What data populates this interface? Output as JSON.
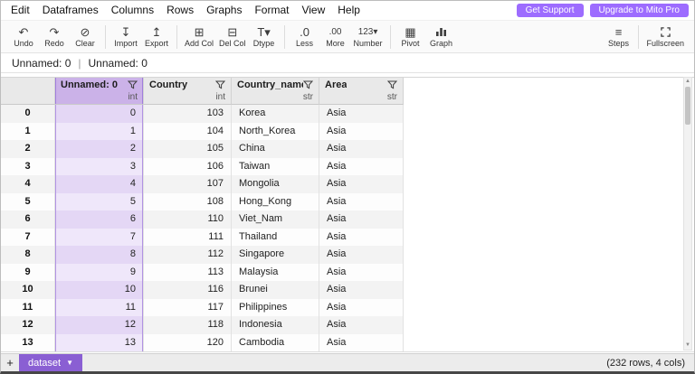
{
  "brand": {
    "accent_purple": "#9d6cff",
    "tab_purple": "#8a5fd3",
    "selected_header": "#cbb2e8",
    "selected_cell": "#efe7fa",
    "selected_cell_alt": "#e4d7f5"
  },
  "menu": {
    "items": [
      "Edit",
      "Dataframes",
      "Columns",
      "Rows",
      "Graphs",
      "Format",
      "View",
      "Help"
    ]
  },
  "header_actions": {
    "get_support": "Get Support",
    "upgrade": "Upgrade to Mito Pro"
  },
  "toolbar": {
    "groups": [
      [
        {
          "name": "undo",
          "label": "Undo",
          "icon": "undo-icon"
        },
        {
          "name": "redo",
          "label": "Redo",
          "icon": "redo-icon"
        },
        {
          "name": "clear",
          "label": "Clear",
          "icon": "clear-icon"
        }
      ],
      [
        {
          "name": "import",
          "label": "Import",
          "icon": "import-icon"
        },
        {
          "name": "export",
          "label": "Export",
          "icon": "export-icon"
        }
      ],
      [
        {
          "name": "add-col",
          "label": "Add Col",
          "icon": "add-col-icon"
        },
        {
          "name": "del-col",
          "label": "Del Col",
          "icon": "del-col-icon"
        },
        {
          "name": "dtype",
          "label": "Dtype",
          "icon": "dtype-icon"
        }
      ],
      [
        {
          "name": "less",
          "label": "Less",
          "icon": "less-icon"
        },
        {
          "name": "more",
          "label": "More",
          "icon": "more-icon"
        },
        {
          "name": "number",
          "label": "Number",
          "icon": "number-icon"
        }
      ],
      [
        {
          "name": "pivot",
          "label": "Pivot",
          "icon": "pivot-icon"
        },
        {
          "name": "graph",
          "label": "Graph",
          "icon": "graph-icon"
        }
      ]
    ],
    "right": [
      {
        "name": "steps",
        "label": "Steps",
        "icon": "steps-icon"
      },
      {
        "name": "fullscreen",
        "label": "Fullscreen",
        "icon": "fullscreen-icon"
      }
    ]
  },
  "formula_bar": {
    "cell_ref": "Unnamed: 0",
    "separator": "|",
    "value": "Unnamed: 0"
  },
  "grid": {
    "columns": [
      {
        "key": "unnamed0",
        "name": "Unnamed: 0",
        "dtype": "int",
        "align": "right",
        "selected": true
      },
      {
        "key": "country",
        "name": "Country",
        "dtype": "int",
        "align": "right",
        "selected": false
      },
      {
        "key": "country-name",
        "name": "Country_name",
        "dtype": "str",
        "align": "left",
        "selected": false
      },
      {
        "key": "area",
        "name": "Area",
        "dtype": "str",
        "align": "left",
        "selected": false
      }
    ],
    "rows": [
      {
        "index": "0",
        "cells": [
          "0",
          "103",
          "Korea",
          "Asia"
        ]
      },
      {
        "index": "1",
        "cells": [
          "1",
          "104",
          "North_Korea",
          "Asia"
        ]
      },
      {
        "index": "2",
        "cells": [
          "2",
          "105",
          "China",
          "Asia"
        ]
      },
      {
        "index": "3",
        "cells": [
          "3",
          "106",
          "Taiwan",
          "Asia"
        ]
      },
      {
        "index": "4",
        "cells": [
          "4",
          "107",
          "Mongolia",
          "Asia"
        ]
      },
      {
        "index": "5",
        "cells": [
          "5",
          "108",
          "Hong_Kong",
          "Asia"
        ]
      },
      {
        "index": "6",
        "cells": [
          "6",
          "110",
          "Viet_Nam",
          "Asia"
        ]
      },
      {
        "index": "7",
        "cells": [
          "7",
          "111",
          "Thailand",
          "Asia"
        ]
      },
      {
        "index": "8",
        "cells": [
          "8",
          "112",
          "Singapore",
          "Asia"
        ]
      },
      {
        "index": "9",
        "cells": [
          "9",
          "113",
          "Malaysia",
          "Asia"
        ]
      },
      {
        "index": "10",
        "cells": [
          "10",
          "116",
          "Brunei",
          "Asia"
        ]
      },
      {
        "index": "11",
        "cells": [
          "11",
          "117",
          "Philippines",
          "Asia"
        ]
      },
      {
        "index": "12",
        "cells": [
          "12",
          "118",
          "Indonesia",
          "Asia"
        ]
      },
      {
        "index": "13",
        "cells": [
          "13",
          "120",
          "Cambodia",
          "Asia"
        ]
      }
    ]
  },
  "footer": {
    "add_sheet": "+",
    "sheet_tab": "dataset",
    "status": "(232 rows, 4 cols)"
  }
}
